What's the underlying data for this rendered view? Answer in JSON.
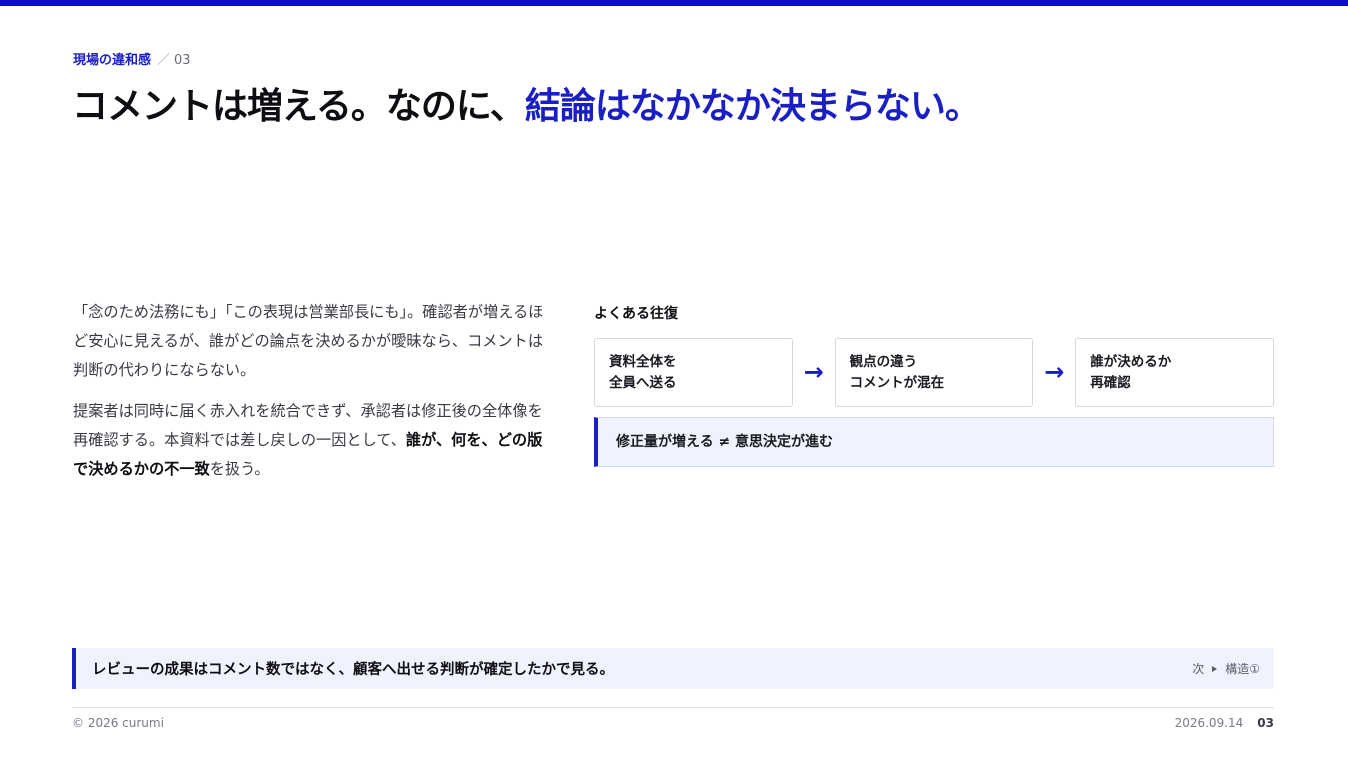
{
  "kicker": {
    "section": "現場の違和感",
    "divider": "／",
    "number": "03"
  },
  "headline": {
    "part1": "コメントは増える。なのに、",
    "part2": "結論はなかなか決まらない。"
  },
  "body": {
    "p1": "「念のため法務にも」「この表現は営業部長にも」。確認者が増えるほど安心に見えるが、誰がどの論点を決めるかが曖昧なら、コメントは判断の代わりにならない。",
    "p2_pre": "提案者は同時に届く赤入れを統合できず、承認者は修正後の全体像を再確認する。本資料では差し戻しの一因として、",
    "p2_bold": "誰が、何を、どの版で決めるかの不一致",
    "p2_post": "を扱う。"
  },
  "flow": {
    "title": "よくある往復",
    "steps": [
      {
        "line1": "資料全体を",
        "line2": "全員へ送る"
      },
      {
        "line1": "観点の違う",
        "line2": "コメントが混在"
      },
      {
        "line1": "誰が決めるか",
        "line2": "再確認"
      }
    ],
    "arrow": "→",
    "conclusion": "修正量が増える ≠ 意思決定が進む"
  },
  "summary": {
    "text": "レビューの成果はコメント数ではなく、顧客へ出せる判断が確定したかで見る。",
    "next_prefix": "次",
    "next_label": "構造①"
  },
  "footer": {
    "copyright": "© 2026 curumi",
    "date": "2026.09.14",
    "page": "03"
  },
  "colors": {
    "accent": "#1a1fc4",
    "topbar": "#0a0fbf",
    "panel": "#f0f2fd"
  }
}
